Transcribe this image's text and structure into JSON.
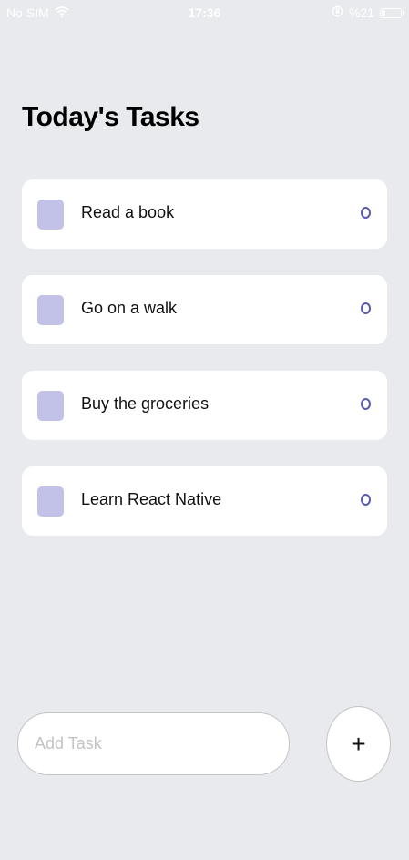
{
  "status_bar": {
    "carrier": "No SIM",
    "time": "17:36",
    "battery": "%21",
    "battery_level": 0.21
  },
  "header": {
    "title": "Today's Tasks"
  },
  "tasks": [
    {
      "label": "Read a book"
    },
    {
      "label": "Go on a walk"
    },
    {
      "label": "Buy the groceries"
    },
    {
      "label": "Learn React Native"
    }
  ],
  "footer": {
    "input_placeholder": "Add Task",
    "add_button_label": "+"
  },
  "colors": {
    "background": "#e8eaed",
    "card": "#ffffff",
    "task_square": "#c2c2e8",
    "task_circle": "#5c5cae"
  }
}
